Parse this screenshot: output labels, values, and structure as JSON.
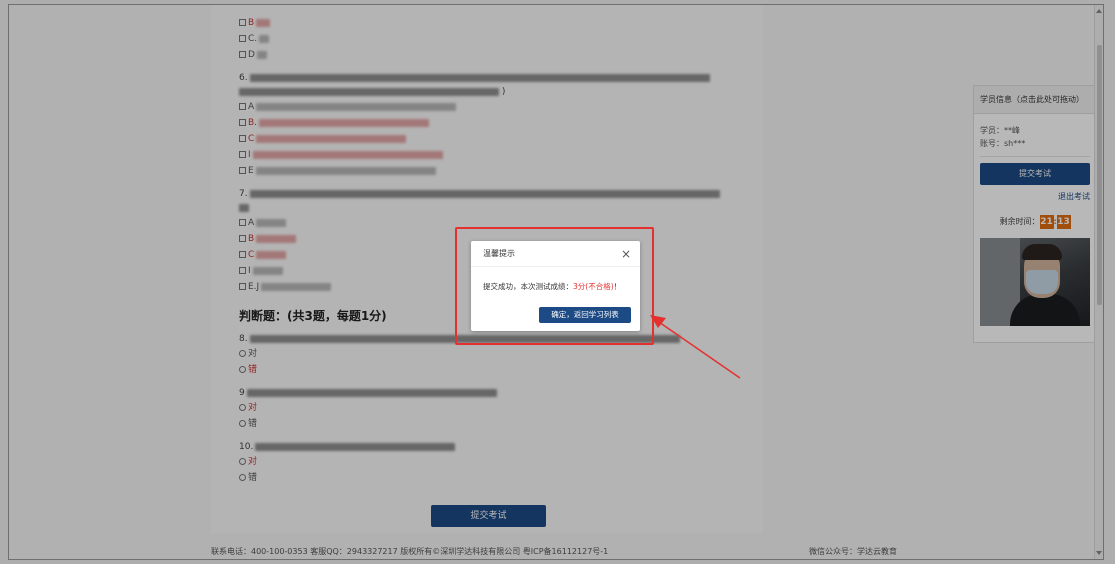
{
  "questions": {
    "q5_options": [
      "B",
      "C.",
      "D"
    ],
    "q6": {
      "number": "6.",
      "tail": ")",
      "options": [
        "A",
        "B.",
        "C",
        "I",
        "E"
      ]
    },
    "q7": {
      "number": "7.",
      "options": [
        "A",
        "B",
        "C",
        "I",
        "E.J"
      ]
    },
    "judge_section_title": "判断题：(共3题，每题1分)",
    "q8": {
      "number": "8."
    },
    "q9": {
      "number": "9"
    },
    "q10": {
      "number": "10."
    },
    "true_label": "对",
    "false_label": "错"
  },
  "main": {
    "submit_label": "提交考试"
  },
  "footer": {
    "left": "联系电话：400-100-0353 客服QQ：2943327217 版权所有©深圳学达科技有限公司  粤ICP备16112127号-1",
    "right": "微信公众号：学达云教育"
  },
  "student_panel": {
    "title": "学员信息（点击此处可拖动）",
    "student_line": "学员：**峰",
    "account_line": "账号：sh***",
    "submit_label": "提交考试",
    "exit_label": "退出考试",
    "timer_label": "剩余时间：",
    "minutes": "21",
    "seconds": "13"
  },
  "dialog": {
    "title": "温馨提示",
    "close": "×",
    "message_prefix": "提交成功，本次测试成绩：",
    "score": "3分(不合格)",
    "message_suffix": "！",
    "confirm_label": "确定，返回学习列表"
  },
  "colors": {
    "accent": "#1c4a84",
    "highlight": "#e53030",
    "timer": "#e06b10"
  }
}
